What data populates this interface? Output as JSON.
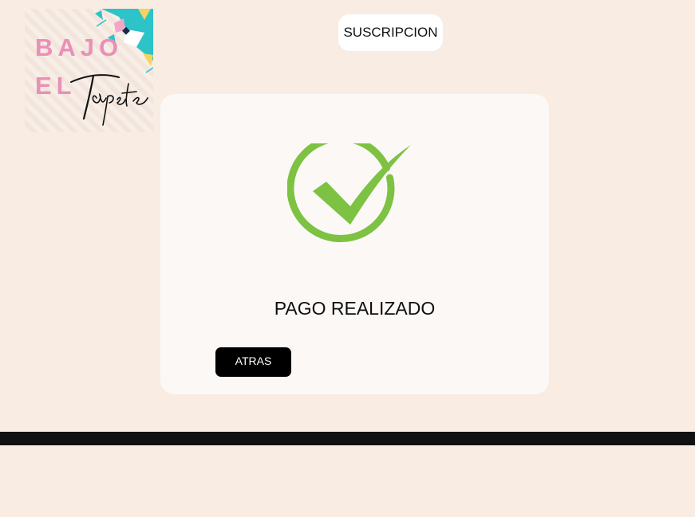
{
  "logo": {
    "word1": "BAJO",
    "word2": "EL",
    "script_text": "Tapete",
    "colors": {
      "pink": "#ea8fb6",
      "teal": "#2cc3c9",
      "navy": "#1b2a4a"
    }
  },
  "header": {
    "subscription_label": "SUSCRIPCION"
  },
  "card": {
    "icon": "check-circle-icon",
    "status_text": "PAGO REALIZADO",
    "back_label": "ATRAS",
    "accent_color": "#7dc242"
  }
}
